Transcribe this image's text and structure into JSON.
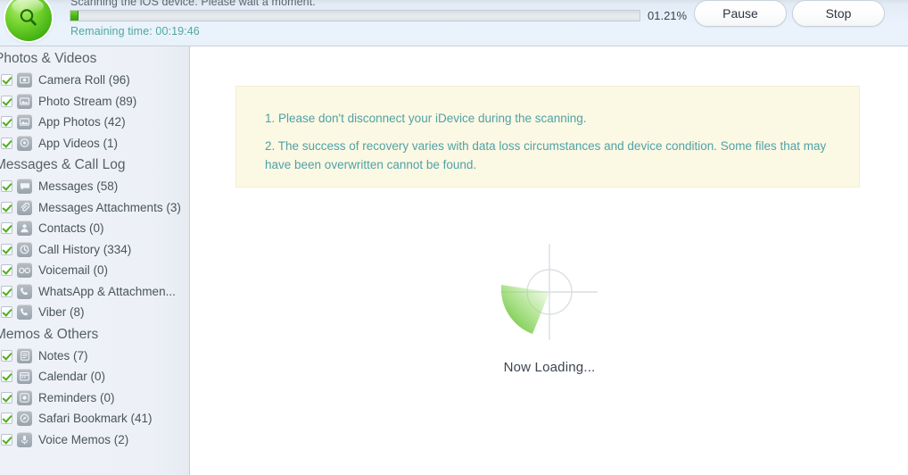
{
  "header": {
    "logo_icon": "magnifier-icon",
    "status_text": "Scanning the iOS device. Please wait a moment.",
    "remaining_label": "Remaining time: 00:19:46",
    "percent_label": "01.21%",
    "progress_value": 1.21,
    "pause_label": "Pause",
    "stop_label": "Stop",
    "accent_color": "#4cb81a",
    "link_color": "#4fa8a0"
  },
  "sidebar": {
    "groups": [
      {
        "title": "Photos & Videos",
        "items": [
          {
            "label": "Camera Roll (96)",
            "icon": "camera-icon",
            "checked": true
          },
          {
            "label": "Photo Stream (89)",
            "icon": "photo-icon",
            "checked": true
          },
          {
            "label": "App Photos (42)",
            "icon": "photo-icon",
            "checked": true
          },
          {
            "label": "App Videos (1)",
            "icon": "video-icon",
            "checked": true
          }
        ]
      },
      {
        "title": "Messages & Call Log",
        "items": [
          {
            "label": "Messages (58)",
            "icon": "message-icon",
            "checked": true
          },
          {
            "label": "Messages Attachments (3)",
            "icon": "paperclip-icon",
            "checked": true
          },
          {
            "label": "Contacts (0)",
            "icon": "contact-icon",
            "checked": true
          },
          {
            "label": "Call History (334)",
            "icon": "clock-icon",
            "checked": true
          },
          {
            "label": "Voicemail (0)",
            "icon": "voicemail-icon",
            "checked": true
          },
          {
            "label": "WhatsApp & Attachmen...",
            "icon": "phone-icon",
            "checked": true
          },
          {
            "label": "Viber (8)",
            "icon": "phone-icon",
            "checked": true
          }
        ]
      },
      {
        "title": "Memos & Others",
        "items": [
          {
            "label": "Notes (7)",
            "icon": "note-icon",
            "checked": true
          },
          {
            "label": "Calendar (0)",
            "icon": "calendar-icon",
            "checked": true
          },
          {
            "label": "Reminders (0)",
            "icon": "reminder-icon",
            "checked": true
          },
          {
            "label": "Safari Bookmark (41)",
            "icon": "compass-icon",
            "checked": true
          },
          {
            "label": "Voice Memos (2)",
            "icon": "microphone-icon",
            "checked": true
          }
        ]
      }
    ]
  },
  "main": {
    "notice": {
      "line1": "1. Please don't disconnect your iDevice during the scanning.",
      "line2": "2. The success of recovery varies with data loss circumstances and device condition. Some files that may have been overwritten cannot be found.",
      "background_color": "#fbf8e4",
      "text_color": "#4fa2a6"
    },
    "loading_text": "Now Loading...",
    "spinner_icon": "radar-scanner-icon",
    "spinner_color": "#5cc22a"
  }
}
